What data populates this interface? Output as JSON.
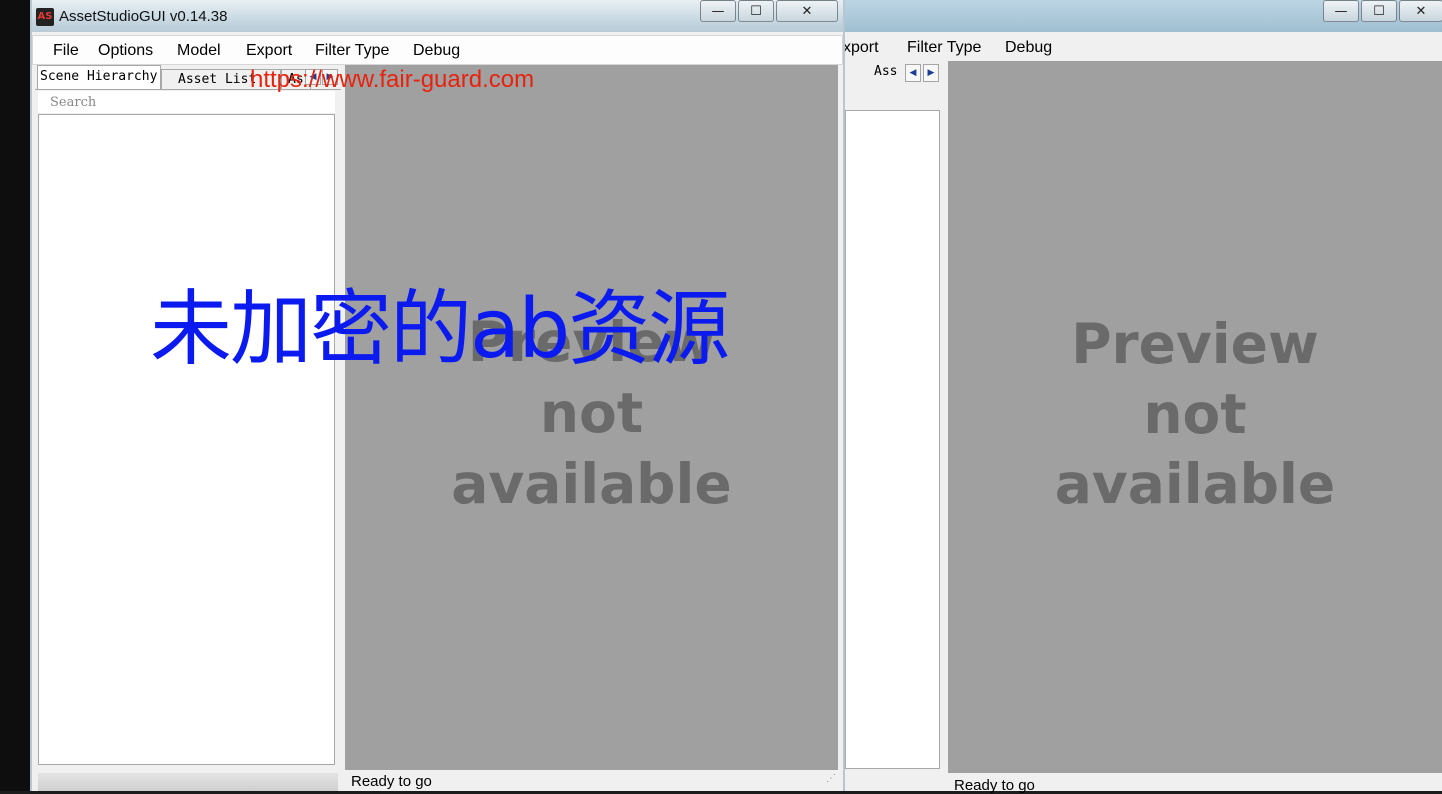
{
  "front_window": {
    "title": "AssetStudioGUI v0.14.38",
    "app_icon_text": "AS",
    "caption_buttons": {
      "minimize": "—",
      "maximize": "☐",
      "close": "✕"
    },
    "menu": [
      "File",
      "Options",
      "Model",
      "Export",
      "Filter Type",
      "Debug"
    ],
    "tabs": [
      "Scene Hierarchy",
      "Asset List",
      "As"
    ],
    "search_placeholder": "Search",
    "preview_text": [
      "Preview",
      "not",
      "available"
    ],
    "status": "Ready to go"
  },
  "back_window": {
    "caption_buttons": {
      "minimize": "—",
      "maximize": "☐",
      "close": "✕"
    },
    "menu_visible": [
      "xport",
      "Filter Type",
      "Debug"
    ],
    "tab_fragment": "Ass",
    "tab_arrows": [
      "◀",
      "▶"
    ],
    "preview_text": [
      "Preview",
      "not",
      "available"
    ],
    "status": "Ready to go"
  },
  "overlay": {
    "watermark_url": "https://www.fair-guard.com",
    "caption": "未加密的ab资源"
  },
  "colors": {
    "preview_bg": "#a0a0a0",
    "preview_text": "#6a6a6a",
    "watermark": "#e8220c",
    "caption": "#0b1bf0"
  }
}
